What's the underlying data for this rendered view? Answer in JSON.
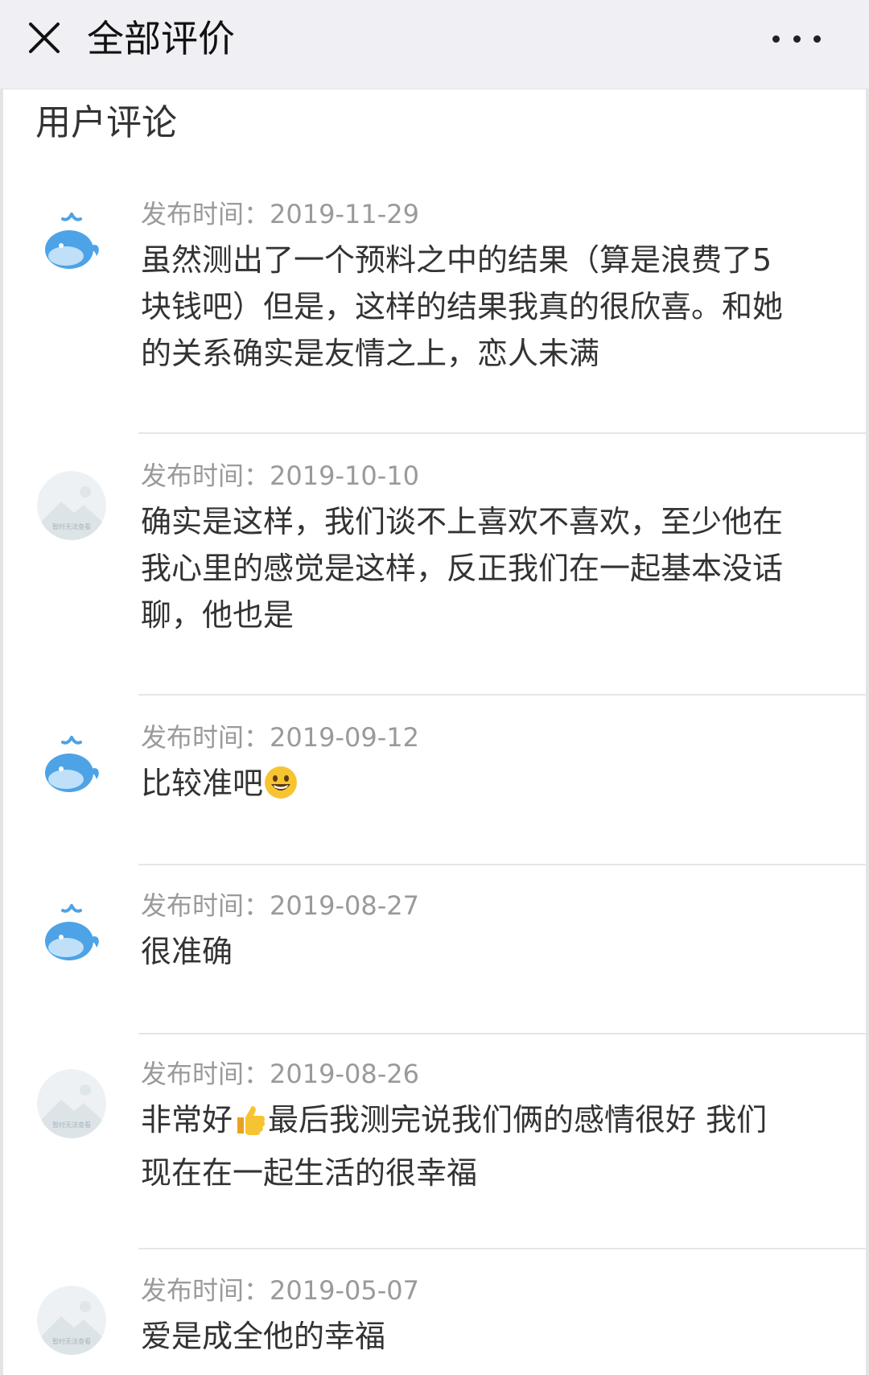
{
  "header": {
    "title": "全部评价"
  },
  "section": {
    "title": "用户评论"
  },
  "comments": [
    {
      "avatar": "whale-avatar",
      "time_label": "发布时间：2019-11-29",
      "text": "虽然测出了一个预料之中的结果（算是浪费了5块钱吧）但是，这样的结果我真的很欣喜。和她的关系确实是友情之上，恋人未满"
    },
    {
      "avatar": "placeholder-avatar",
      "avatar_text": "暂时无法查看",
      "time_label": "发布时间：2019-10-10",
      "text": "确实是这样，我们谈不上喜欢不喜欢，至少他在我心里的感觉是这样，反正我们在一起基本没话聊，他也是"
    },
    {
      "avatar": "whale-avatar",
      "time_label": "发布时间：2019-09-12",
      "text": "比较准吧",
      "emoji": "grinning-face-emoji"
    },
    {
      "avatar": "whale-avatar",
      "time_label": "发布时间：2019-08-27",
      "text": "很准确"
    },
    {
      "avatar": "placeholder-avatar",
      "avatar_text": "暂时无法查看",
      "time_label": "发布时间：2019-08-26",
      "text_before": "非常好",
      "emoji": "thumbs-up-emoji",
      "text_after": "最后我测完说我们俩的感情很好 我们现在在一起生活的很幸福"
    },
    {
      "avatar": "placeholder-avatar",
      "avatar_text": "暂时无法查看",
      "time_label": "发布时间：2019-05-07",
      "text": "爱是成全他的幸福"
    }
  ],
  "colors": {
    "topbar_bg": "#efeff4",
    "meta_text": "#9a9a9a",
    "body_text": "#333333",
    "whale_blue": "#4da3e6"
  }
}
